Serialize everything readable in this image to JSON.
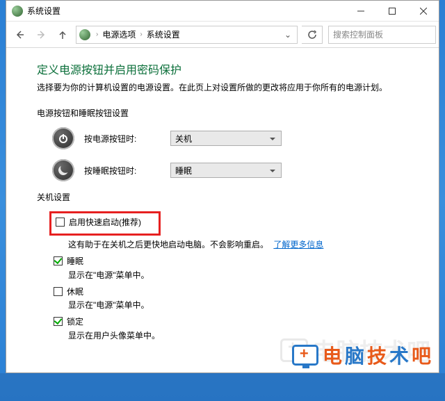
{
  "window": {
    "title": "系统设置"
  },
  "toolbar": {
    "breadcrumb": [
      "电源选项",
      "系统设置"
    ],
    "search_placeholder": "搜索控制面板"
  },
  "page": {
    "title": "定义电源按钮并启用密码保护",
    "description": "选择要为你的计算机设置的电源设置。在此页上对设置所做的更改将应用于你所有的电源计划。"
  },
  "section_buttons": {
    "header": "电源按钮和睡眠按钮设置",
    "rows": [
      {
        "icon": "power",
        "label": "按电源按钮时:",
        "value": "关机"
      },
      {
        "icon": "sleep",
        "label": "按睡眠按钮时:",
        "value": "睡眠"
      }
    ]
  },
  "section_shutdown": {
    "header": "关机设置",
    "fast_startup": {
      "checked": false,
      "label": "启用快速启动(推荐)",
      "desc_prefix": "这有助于在关机之后更快地启动电脑。不会影响重启。",
      "link": "了解更多信息"
    },
    "options": [
      {
        "checked": true,
        "label": "睡眠",
        "desc": "显示在\"电源\"菜单中。"
      },
      {
        "checked": false,
        "label": "休眠",
        "desc": "显示在\"电源\"菜单中。"
      },
      {
        "checked": true,
        "label": "锁定",
        "desc": "显示在用户头像菜单中。"
      }
    ]
  },
  "overlay_logo": "电脑技术吧"
}
